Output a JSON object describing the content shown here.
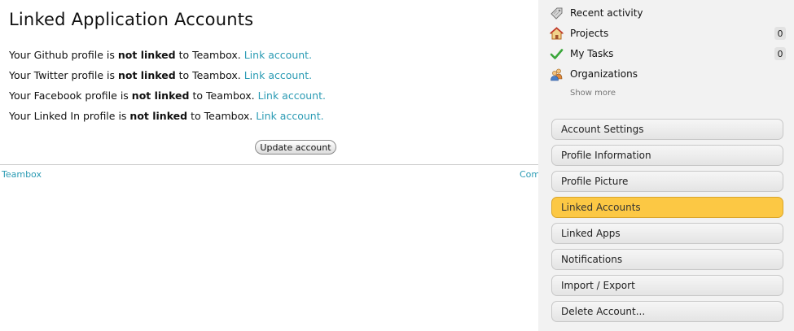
{
  "main": {
    "title": "Linked Application Accounts",
    "rows": [
      {
        "prefix": "Your Github profile is",
        "status": "not linked",
        "suffix": "to Teambox.",
        "link": "Link account."
      },
      {
        "prefix": "Your Twitter profile is",
        "status": "not linked",
        "suffix": "to Teambox.",
        "link": "Link account."
      },
      {
        "prefix": "Your Facebook profile is",
        "status": "not linked",
        "suffix": "to Teambox.",
        "link": "Link account."
      },
      {
        "prefix": "Your Linked In profile is",
        "status": "not linked",
        "suffix": "to Teambox.",
        "link": "Link account."
      }
    ],
    "update_button": "Update account",
    "footer": {
      "left": "Teambox",
      "right": "Com"
    }
  },
  "sidebar": {
    "nav": [
      {
        "label": "Recent activity",
        "icon": "tag-icon"
      },
      {
        "label": "Projects",
        "icon": "house-icon",
        "count": "0"
      },
      {
        "label": "My Tasks",
        "icon": "checkmark-icon",
        "count": "0"
      },
      {
        "label": "Organizations",
        "icon": "people-icon"
      }
    ],
    "show_more": "Show more",
    "settings": [
      {
        "label": "Account Settings"
      },
      {
        "label": "Profile Information"
      },
      {
        "label": "Profile Picture"
      },
      {
        "label": "Linked Accounts",
        "active": true
      },
      {
        "label": "Linked Apps"
      },
      {
        "label": "Notifications"
      },
      {
        "label": "Import / Export"
      },
      {
        "label": "Delete Account..."
      }
    ]
  },
  "colors": {
    "link": "#2b9bb4",
    "active_button": "#fcc844",
    "sidebar_bg": "#f2f2f2"
  }
}
